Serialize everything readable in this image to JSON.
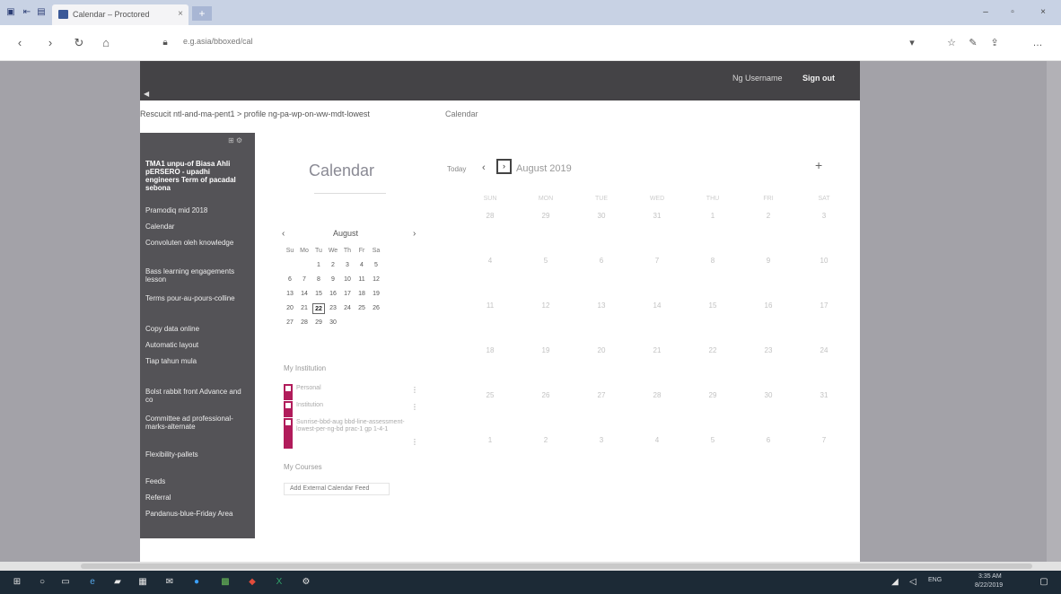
{
  "browser": {
    "tab_title": "Calendar – Proctored",
    "url": "e.g.asia/bboxed/cal",
    "new_tab_symbol": "+",
    "close_symbol": "×",
    "window_min": "–",
    "window_max": "▫",
    "window_close": "×"
  },
  "header": {
    "user_name": "Ng Username",
    "logout_label": "Sign out"
  },
  "breadcrumb": {
    "path": "Rescucit ntl-and-ma-pent1 > profile ng-pa-wp-on-ww-mdt-lowest",
    "current": "Calendar"
  },
  "course_nav": {
    "title": "TMA1 unpu-of Biasa Ahli pERSERO - upadhi engineers Term of pacadal sebona",
    "items": [
      "Pramodiq mid 2018",
      "Calendar",
      "Convoluten oleh knowledge",
      "Bass learning engagements lesson",
      "Terms pour-au-pours-colline",
      "Copy data online",
      "Automatic layout",
      "Tiap tahun mula",
      "Bolst rabbit front Advance and co",
      "Committee ad professional-marks-alternate",
      "Flexibility-pallets",
      "Feeds",
      "Referral",
      "Pandanus-blue-Friday Area"
    ]
  },
  "sidebar": {
    "heading": "Calendar",
    "mini_month": "August",
    "prev": "‹",
    "next": "›",
    "dow": [
      "Su",
      "Mo",
      "Tu",
      "We",
      "Th",
      "Fr",
      "Sa"
    ],
    "weeks": [
      [
        "",
        "",
        "1",
        "2",
        "3",
        "4",
        "5"
      ],
      [
        "6",
        "7",
        "8",
        "9",
        "10",
        "11",
        "12"
      ],
      [
        "13",
        "14",
        "15",
        "16",
        "17",
        "18",
        "19"
      ],
      [
        "20",
        "21",
        "22",
        "23",
        "24",
        "25",
        "26"
      ],
      [
        "27",
        "28",
        "29",
        "30",
        "",
        "",
        ""
      ]
    ],
    "today": "22",
    "my_calendars_label": "My Institution",
    "calendars": [
      {
        "name": "Personal",
        "more": "⋮"
      },
      {
        "name": "Institution",
        "more": "⋮"
      },
      {
        "name": "Sunrise-bbd-aug bbd-line-assessment-lowest-per-ng-bd prac-1 gp 1-4-1",
        "more": "⋮"
      }
    ],
    "other_calendars_label": "My Courses",
    "add_calendar_label": "Add External Calendar Feed"
  },
  "month": {
    "today_label": "Today",
    "prev": "‹",
    "next": "›",
    "title": "August 2019",
    "add_symbol": "+",
    "dow": [
      "SUN",
      "MON",
      "TUE",
      "WED",
      "THU",
      "FRI",
      "SAT"
    ],
    "weeks": [
      [
        "28",
        "29",
        "30",
        "31",
        "1",
        "2",
        "3"
      ],
      [
        "4",
        "5",
        "6",
        "7",
        "8",
        "9",
        "10"
      ],
      [
        "11",
        "12",
        "13",
        "14",
        "15",
        "16",
        "17"
      ],
      [
        "18",
        "19",
        "20",
        "21",
        "22",
        "23",
        "24"
      ],
      [
        "25",
        "26",
        "27",
        "28",
        "29",
        "30",
        "31"
      ],
      [
        "1",
        "2",
        "3",
        "4",
        "5",
        "6",
        "7"
      ]
    ]
  },
  "taskbar": {
    "tray_lang": "ENG",
    "tray_time": "3:35 AM",
    "tray_date": "8/22/2019"
  },
  "colors": {
    "header_bg": "#444346",
    "course_nav_bg": "#545357",
    "calendar_accent": "#b11c5b",
    "backdrop": "#a3a2a8"
  }
}
